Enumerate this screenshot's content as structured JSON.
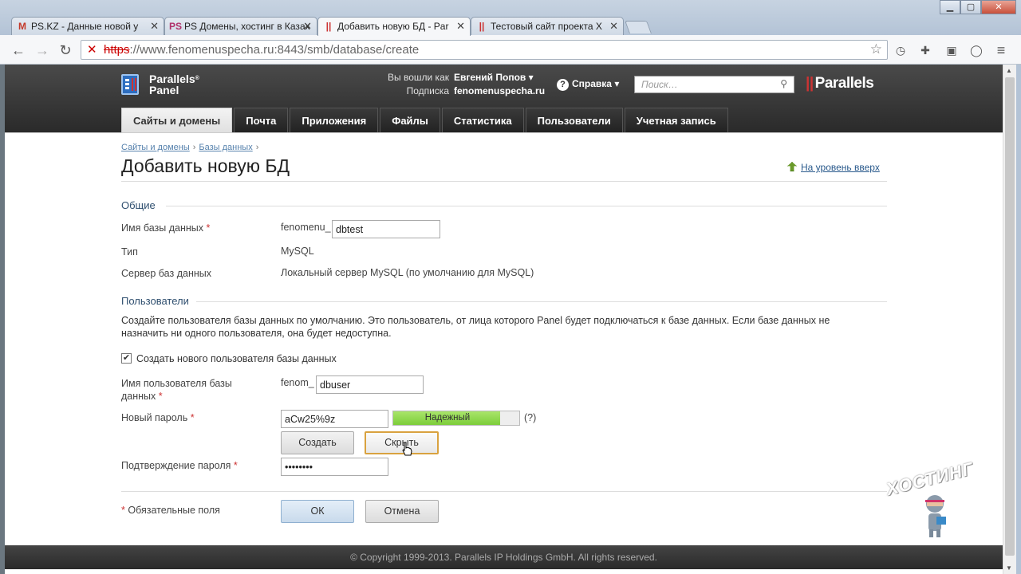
{
  "browser": {
    "tabs": [
      {
        "label": "PS.KZ - Данные новой у",
        "icon": "M",
        "icon_color": "#c4392a"
      },
      {
        "label": "PS Домены, хостинг в Казах",
        "icon": "PS",
        "icon_color": "#b0306a"
      },
      {
        "label": "Добавить новую БД - Par",
        "icon": "||",
        "icon_color": "#c33"
      },
      {
        "label": "Тестовый сайт проекта Х",
        "icon": "||",
        "icon_color": "#c33"
      }
    ],
    "url_scheme": "https",
    "url_rest": "://www.fenomenuspecha.ru:8443/smb/database/create"
  },
  "header": {
    "logo_line1": "Parallels",
    "logo_line2": "Panel",
    "logged_in_label": "Вы вошли как",
    "user_name": "Евгений Попов",
    "subscription_label": "Подписка",
    "subscription_value": "fenomenuspecha.ru",
    "help_label": "Справка",
    "search_placeholder": "Поиск…",
    "brand": "Parallels"
  },
  "nav": {
    "tabs": [
      "Сайты и домены",
      "Почта",
      "Приложения",
      "Файлы",
      "Статистика",
      "Пользователи",
      "Учетная запись"
    ],
    "active": "Сайты и домены"
  },
  "breadcrumb": [
    "Сайты и домены",
    "Базы данных"
  ],
  "page_title": "Добавить новую БД",
  "up_link": "На уровень вверх",
  "general": {
    "heading": "Общие",
    "db_name_label": "Имя базы данных",
    "db_prefix": "fenomenu_",
    "db_name_value": "dbtest",
    "type_label": "Тип",
    "type_value": "MySQL",
    "server_label": "Сервер баз данных",
    "server_value": "Локальный сервер MySQL (по умолчанию для MySQL)"
  },
  "users": {
    "heading": "Пользователи",
    "note": "Создайте пользователя базы данных по умолчанию. Это пользователь, от лица которого Panel будет подключаться к базе данных. Если базе данных не назначить ни одного пользователя, она будет недоступна.",
    "create_user_label": "Создать нового пользователя базы данных",
    "create_user_checked": true,
    "username_label_1": "Имя пользователя базы",
    "username_label_2": "данных",
    "username_prefix": "fenom_",
    "username_value": "dbuser",
    "password_label": "Новый пароль",
    "password_value": "aCw25%9z",
    "strength_label": "Надежный",
    "strength_fraction": 0.85,
    "strength_help": "(?)",
    "generate_button": "Создать",
    "hide_button": "Скрыть",
    "confirm_label": "Подтверждение пароля",
    "confirm_value": "••••••••"
  },
  "required_note": "Обязательные поля",
  "required_mark": "*",
  "ok_button": "ОК",
  "cancel_button": "Отмена",
  "footer": "© Copyright 1999-2013. Parallels IP Holdings GmbH. All rights reserved.",
  "watermark": "ХОСТИНГ"
}
